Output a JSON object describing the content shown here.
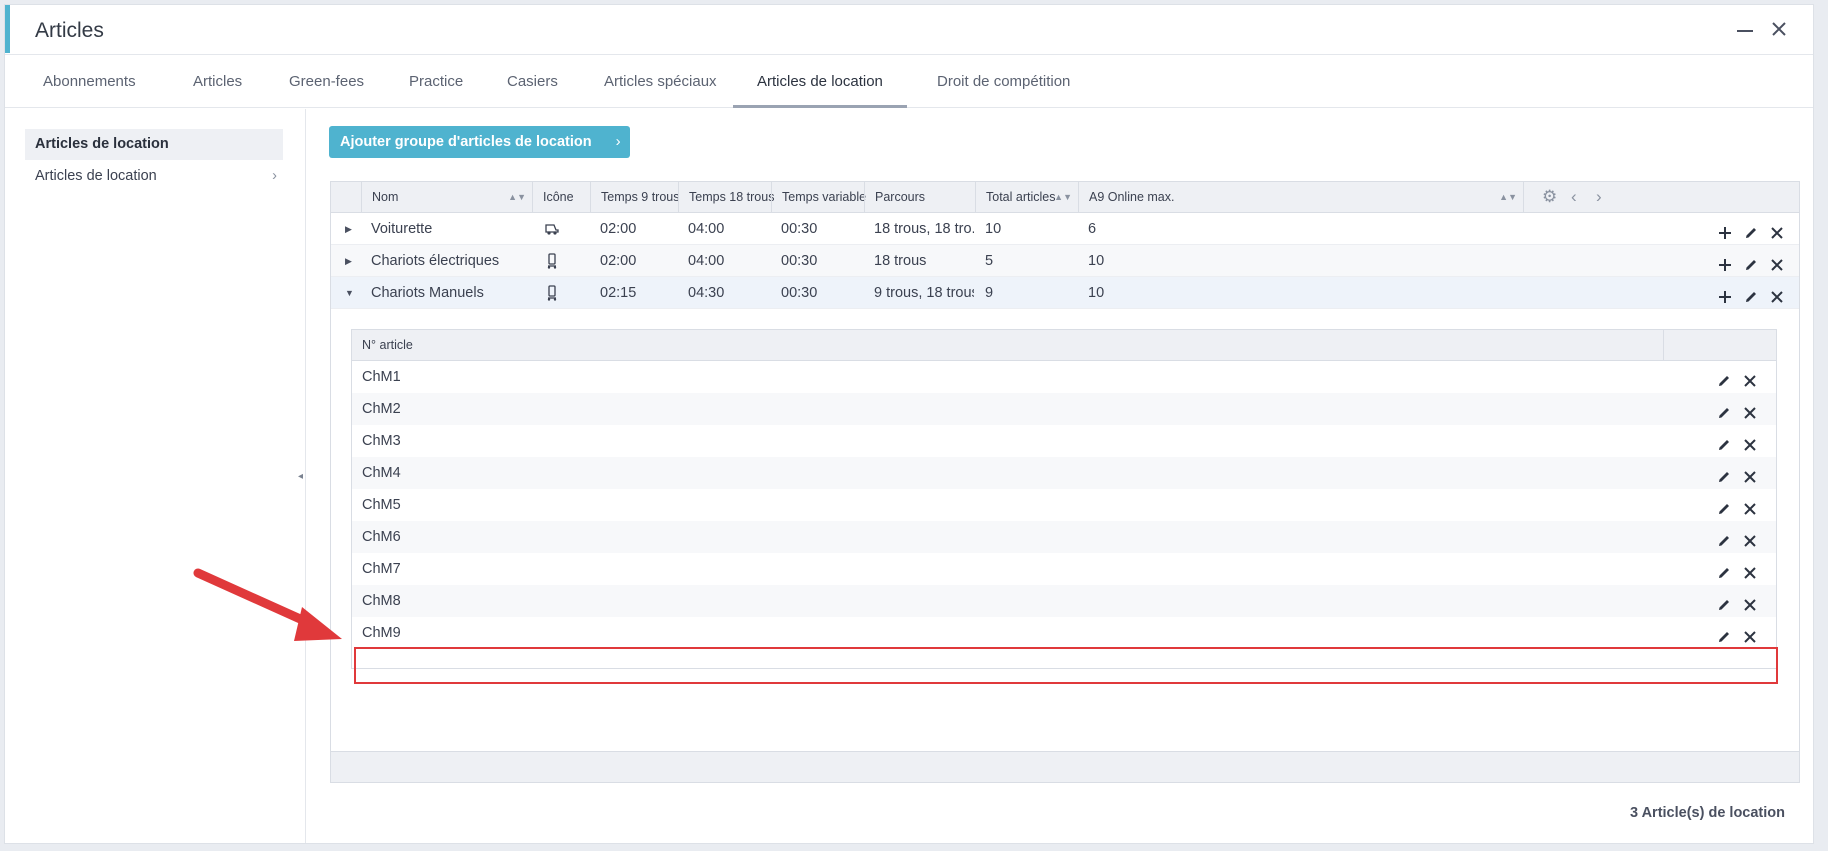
{
  "window": {
    "title": "Articles",
    "minimize_icon": "minimize-icon",
    "close_icon": "close-icon"
  },
  "tabs": [
    {
      "label": "Abonnements"
    },
    {
      "label": "Articles"
    },
    {
      "label": "Green-fees"
    },
    {
      "label": "Practice"
    },
    {
      "label": "Casiers"
    },
    {
      "label": "Articles spéciaux"
    },
    {
      "label": "Articles de location",
      "active": true
    },
    {
      "label": "Droit de compétition"
    }
  ],
  "sidebar": {
    "items": [
      {
        "label": "Articles de location",
        "selected": true
      },
      {
        "label": "Articles de location",
        "icon": "chevron-right-icon"
      }
    ]
  },
  "add_group_button": {
    "label": "Ajouter groupe d'articles de location"
  },
  "grid": {
    "columns": [
      "Nom",
      "Icône",
      "Temps 9 trous",
      "Temps 18 trous",
      "Temps variable",
      "Parcours",
      "Total articles",
      "A9 Online max."
    ],
    "rows": [
      {
        "nom": "Voiturette",
        "icon": "golf-cart-icon",
        "t9": "02:00",
        "t18": "04:00",
        "tv": "00:30",
        "parcours": "18 trous, 18 tro...",
        "total": "10",
        "online": "6",
        "expanded": false
      },
      {
        "nom": "Chariots électriques",
        "icon": "golf-trolley-icon",
        "t9": "02:00",
        "t18": "04:00",
        "tv": "00:30",
        "parcours": "18 trous",
        "total": "5",
        "online": "10",
        "expanded": false
      },
      {
        "nom": "Chariots Manuels",
        "icon": "golf-trolley-icon",
        "t9": "02:15",
        "t18": "04:30",
        "tv": "00:30",
        "parcours": "9 trous, 18 trous",
        "total": "9",
        "online": "10",
        "expanded": true
      }
    ],
    "subgrid": {
      "column": "N° article",
      "rows": [
        "ChM1",
        "ChM2",
        "ChM3",
        "ChM4",
        "ChM5",
        "ChM6",
        "ChM7",
        "ChM8",
        "ChM9"
      ],
      "new_row_value": ""
    }
  },
  "footer": {
    "count": "3 Article(s) de location"
  },
  "colors": {
    "accent": "#4fb3cf",
    "highlight": "#e0393b"
  }
}
